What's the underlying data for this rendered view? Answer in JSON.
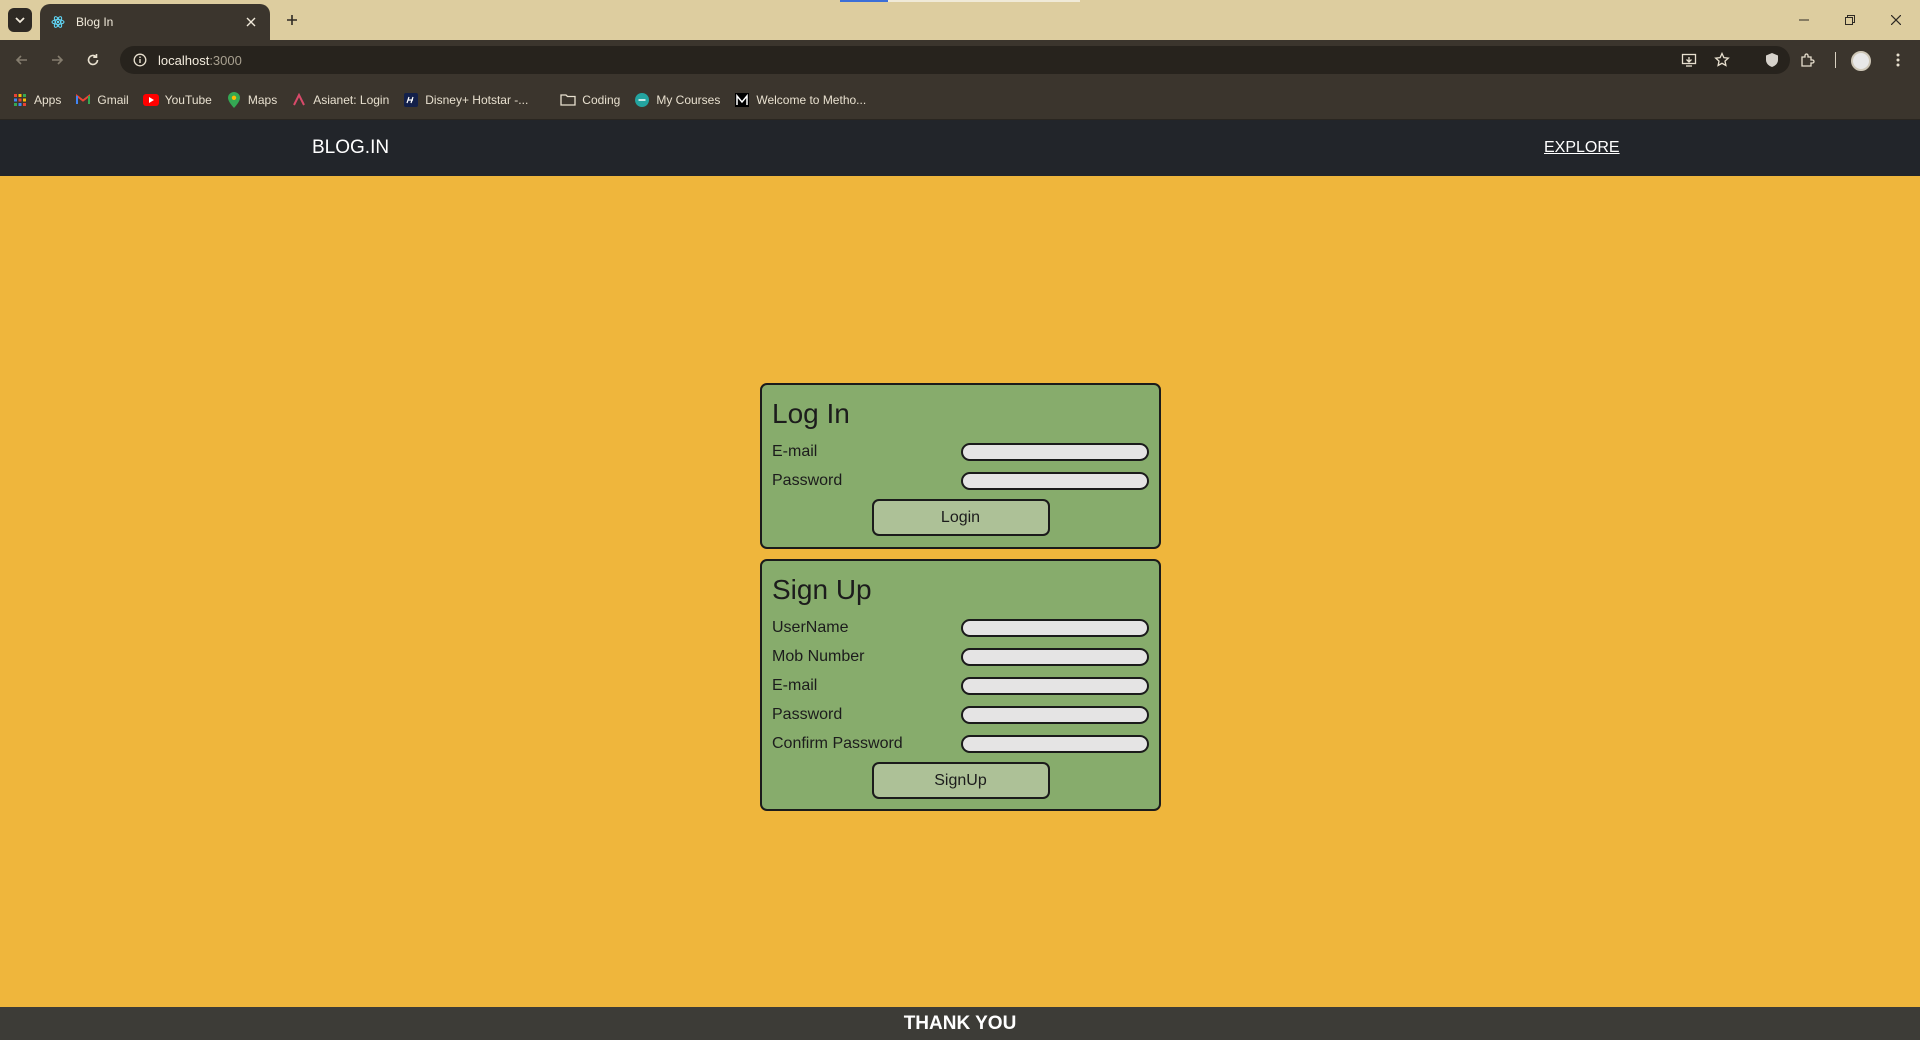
{
  "browser": {
    "tab_title": "Blog In",
    "url_host": "localhost",
    "url_port": ":3000",
    "bookmarks": [
      {
        "label": "Apps",
        "icon": "apps-grid-icon"
      },
      {
        "label": "Gmail",
        "icon": "gmail-icon"
      },
      {
        "label": "YouTube",
        "icon": "youtube-icon"
      },
      {
        "label": "Maps",
        "icon": "maps-icon"
      },
      {
        "label": "Asianet: Login",
        "icon": "asianet-icon"
      },
      {
        "label": "Disney+ Hotstar -...",
        "icon": "hotstar-icon"
      },
      {
        "label": "Coding",
        "icon": "folder-icon"
      },
      {
        "label": "My Courses",
        "icon": "courses-icon"
      },
      {
        "label": "Welcome to Metho...",
        "icon": "metho-icon"
      }
    ]
  },
  "navbar": {
    "brand": "BLOG.IN",
    "explore": "EXPLORE"
  },
  "login": {
    "title": "Log In",
    "fields": [
      {
        "label": "E-mail",
        "value": ""
      },
      {
        "label": "Password",
        "value": ""
      }
    ],
    "button": "Login"
  },
  "signup": {
    "title": "Sign Up",
    "fields": [
      {
        "label": "UserName",
        "value": ""
      },
      {
        "label": "Mob Number",
        "value": ""
      },
      {
        "label": "E-mail",
        "value": ""
      },
      {
        "label": "Password",
        "value": ""
      },
      {
        "label": "Confirm Password",
        "value": ""
      }
    ],
    "button": "SignUp"
  },
  "footer": {
    "text": "THANK YOU"
  },
  "colors": {
    "page_background": "#efb63c",
    "navbar": "#22252a",
    "card": "#87ac6c",
    "button": "#adc197",
    "footer": "#3d3c37"
  }
}
